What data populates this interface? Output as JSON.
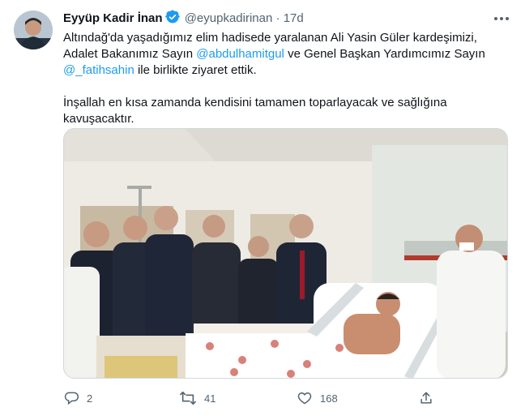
{
  "tweet": {
    "author_name": "Eyyüp Kadir İnan",
    "handle": "@eyupkadirinan",
    "separator": "·",
    "time": "17d",
    "text": {
      "p1_a": "Altındağ'da yaşadığımız elim hadisede yaralanan Ali Yasin Güler kardeşimizi, Adalet Bakanımız Sayın ",
      "mention_1": "@abdulhamitgul",
      "p1_b": " ve Genel Başkan Yardımcımız Sayın ",
      "mention_2": "@_fatihsahin",
      "p1_c": " ile birlikte ziyaret ettik.",
      "p2": "İnşallah en kısa zamanda kendisini tamamen toparlayacak ve sağlığına kavuşacaktır."
    }
  },
  "icons": {
    "verified": "verified-badge-icon",
    "more": "more-options-icon",
    "reply": "reply-icon",
    "retweet": "retweet-icon",
    "like": "like-icon",
    "share": "share-icon"
  },
  "actions": {
    "reply_count": "2",
    "retweet_count": "41",
    "like_count": "168"
  },
  "colors": {
    "accent": "#1d9bf0",
    "text": "#0f1419",
    "secondary": "#536471"
  }
}
